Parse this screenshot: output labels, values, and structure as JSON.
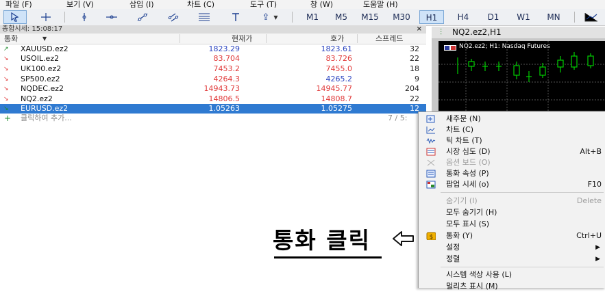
{
  "menubar": {
    "items": [
      {
        "label": "파일 (F)"
      },
      {
        "label": "보기 (V)"
      },
      {
        "label": "삽입 (I)"
      },
      {
        "label": "차트 (C)"
      },
      {
        "label": "도구 (T)"
      },
      {
        "label": "창 (W)"
      },
      {
        "label": "도움말 (H)"
      }
    ]
  },
  "toolbar": {
    "timeframes": [
      {
        "label": "M1"
      },
      {
        "label": "M5"
      },
      {
        "label": "M15"
      },
      {
        "label": "M30"
      },
      {
        "label": "H1",
        "selected": true
      },
      {
        "label": "H4"
      },
      {
        "label": "D1"
      },
      {
        "label": "W1"
      },
      {
        "label": "MN"
      }
    ]
  },
  "market_watch": {
    "title": "종합시세: 15:08:17",
    "close": "×",
    "headers": {
      "symbol": "통화",
      "bid": "현재가",
      "ask": "호가",
      "spread": "스프레드"
    },
    "rows": [
      {
        "symbol": "XAUUSD.ez2",
        "bid": "1823.29",
        "ask": "1823.61",
        "spread": "32",
        "dir": "up"
      },
      {
        "symbol": "USOIL.ez2",
        "bid": "83.704",
        "ask": "83.726",
        "spread": "22",
        "dir": "down"
      },
      {
        "symbol": "UK100.ez2",
        "bid": "7453.2",
        "ask": "7455.0",
        "spread": "18",
        "dir": "down"
      },
      {
        "symbol": "SP500.ez2",
        "bid": "4264.3",
        "ask": "4265.2",
        "spread": "9",
        "dir": "down"
      },
      {
        "symbol": "NQDEC.ez2",
        "bid": "14943.73",
        "ask": "14945.77",
        "spread": "204",
        "dir": "down"
      },
      {
        "symbol": "NQ2.ez2",
        "bid": "14806.5",
        "ask": "14808.7",
        "spread": "22",
        "dir": "down"
      },
      {
        "symbol": "EURUSD.ez2",
        "bid": "1.05263",
        "ask": "1.05275",
        "spread": "12",
        "dir": "down",
        "selected": true
      }
    ],
    "add_label": "클릭하여 추가...",
    "count": "7 / 5:"
  },
  "chart": {
    "window_title": "NQ2.ez2,H1",
    "info": "NQ2.ez2; H1: Nasdaq Futures"
  },
  "context_menu": {
    "items": [
      {
        "label": "새주문 (N)",
        "shortcut": "",
        "icon": "new-order-icon"
      },
      {
        "label": "차트 (C)",
        "shortcut": "",
        "icon": "chart-icon"
      },
      {
        "label": "틱 차트 (T)",
        "shortcut": "",
        "icon": "tick-chart-icon"
      },
      {
        "label": "시장 심도 (D)",
        "shortcut": "Alt+B",
        "icon": "depth-icon"
      },
      {
        "label": "옵션 보드 (O)",
        "shortcut": "",
        "icon": "option-board-icon",
        "disabled": true
      },
      {
        "label": "통화 속성 (P)",
        "shortcut": "",
        "icon": "properties-icon"
      },
      {
        "label": "팝업 시세 (o)",
        "shortcut": "F10",
        "icon": "popup-prices-icon"
      },
      {
        "label": "숨기기 (I)",
        "shortcut": "Delete",
        "disabled": true
      },
      {
        "label": "모두 숨기기 (H)",
        "shortcut": ""
      },
      {
        "label": "모두 표시 (S)",
        "shortcut": ""
      },
      {
        "label": "통화 (Y)",
        "shortcut": "Ctrl+U",
        "icon": "symbols-icon"
      },
      {
        "label": "설정",
        "submenu": true
      },
      {
        "label": "정렬",
        "submenu": true
      },
      {
        "label": "시스템 색상 사용 (L)",
        "shortcut": ""
      },
      {
        "label": "멀리츠 표시 (M)",
        "shortcut": ""
      }
    ]
  },
  "annotation": {
    "text": "통화 클릭"
  },
  "colors": {
    "up": "#2a44c0",
    "down": "#e03838",
    "selected": "#2f7ad1"
  }
}
